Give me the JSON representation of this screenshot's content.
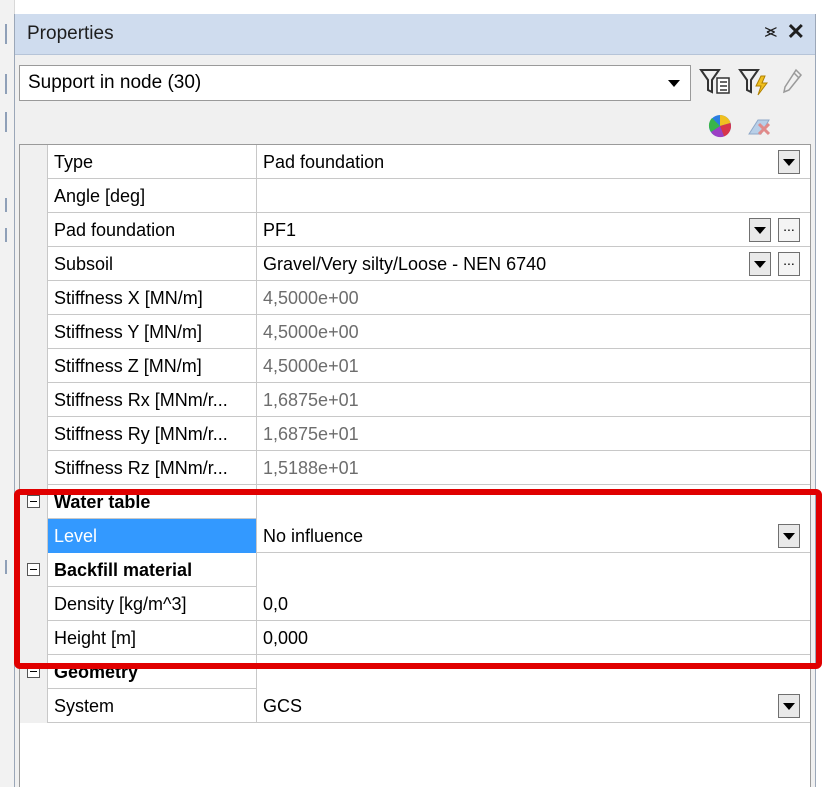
{
  "panel": {
    "title": "Properties",
    "pin_glyph": "⪤",
    "close_glyph": "✕"
  },
  "selector": {
    "value": "Support in node (30)"
  },
  "toolbar": {
    "icons": [
      "filter-icon",
      "filter-lightning-icon",
      "pencil-icon",
      "color-palette-icon",
      "clear-icon"
    ]
  },
  "rows": [
    {
      "kind": "prop",
      "name": "Type",
      "value": "Pad foundation",
      "dropdown": true,
      "ellipsis": false,
      "readonly": false
    },
    {
      "kind": "prop",
      "name": "Angle [deg]",
      "value": "",
      "dropdown": false,
      "ellipsis": false,
      "readonly": false
    },
    {
      "kind": "prop",
      "name": "Pad foundation",
      "value": "PF1",
      "dropdown": true,
      "ellipsis": true,
      "readonly": false
    },
    {
      "kind": "prop",
      "name": "Subsoil",
      "value": "Gravel/Very silty/Loose - NEN 6740",
      "dropdown": true,
      "ellipsis": true,
      "readonly": false
    },
    {
      "kind": "prop",
      "name": "Stiffness X [MN/m]",
      "value": "4,5000e+00",
      "dropdown": false,
      "ellipsis": false,
      "readonly": true
    },
    {
      "kind": "prop",
      "name": "Stiffness Y [MN/m]",
      "value": "4,5000e+00",
      "dropdown": false,
      "ellipsis": false,
      "readonly": true
    },
    {
      "kind": "prop",
      "name": "Stiffness Z [MN/m]",
      "value": "4,5000e+01",
      "dropdown": false,
      "ellipsis": false,
      "readonly": true
    },
    {
      "kind": "prop",
      "name": "Stiffness Rx [MNm/r...",
      "value": "1,6875e+01",
      "dropdown": false,
      "ellipsis": false,
      "readonly": true
    },
    {
      "kind": "prop",
      "name": "Stiffness Ry [MNm/r...",
      "value": "1,6875e+01",
      "dropdown": false,
      "ellipsis": false,
      "readonly": true
    },
    {
      "kind": "prop",
      "name": "Stiffness Rz [MNm/r...",
      "value": "1,5188e+01",
      "dropdown": false,
      "ellipsis": false,
      "readonly": true
    },
    {
      "kind": "category",
      "name": "Water table"
    },
    {
      "kind": "prop",
      "name": "Level",
      "value": "No influence",
      "dropdown": true,
      "ellipsis": false,
      "readonly": false,
      "selected": true
    },
    {
      "kind": "category",
      "name": "Backfill material"
    },
    {
      "kind": "prop",
      "name": "Density [kg/m^3]",
      "value": "0,0",
      "dropdown": false,
      "ellipsis": false,
      "readonly": false
    },
    {
      "kind": "prop",
      "name": "Height [m]",
      "value": "0,000",
      "dropdown": false,
      "ellipsis": false,
      "readonly": false
    },
    {
      "kind": "category",
      "name": "Geometry"
    },
    {
      "kind": "prop",
      "name": "System",
      "value": "GCS",
      "dropdown": true,
      "ellipsis": false,
      "readonly": false
    }
  ],
  "colors": {
    "titlebar": "#cfdcee",
    "selection": "#3399ff",
    "highlight": "#e00000",
    "readonly_text": "#6d6d6d"
  }
}
